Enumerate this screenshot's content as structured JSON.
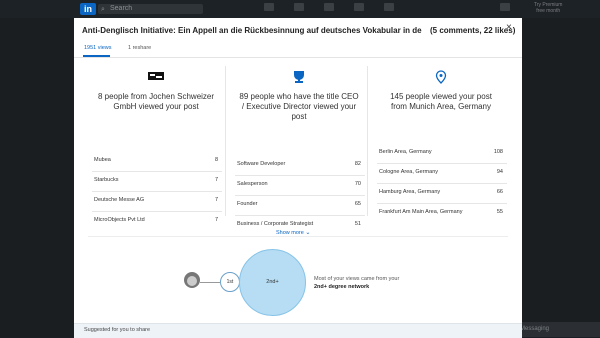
{
  "header": {
    "logo": "in",
    "search_placeholder": "Search",
    "premium_label": "Try Premium\nfree month"
  },
  "background": {
    "messaging": "Messaging"
  },
  "modal": {
    "title": "Anti-Denglisch Initiative: Ein Appell an die Rückbesinnung auf deutsches Vokabular in der Grü...",
    "stats": "(5 comments, 22 likes)",
    "close": "×",
    "tabs": [
      {
        "label": "1951 views",
        "active": true
      },
      {
        "label": "1 reshare",
        "active": false
      }
    ],
    "columns": [
      {
        "icon": "company-logo-icon",
        "headline": "8 people from Jochen Schweizer GmbH viewed your post",
        "rows": [
          {
            "label": "Mubea",
            "value": "8"
          },
          {
            "label": "Starbucks",
            "value": "7"
          },
          {
            "label": "Deutsche Messe AG",
            "value": "7"
          },
          {
            "label": "MicroObjects Pvt Ltd",
            "value": "7"
          }
        ]
      },
      {
        "icon": "trophy-icon",
        "headline": "89 people who have the title CEO / Executive Director viewed your post",
        "rows": [
          {
            "label": "Software Developer",
            "value": "82"
          },
          {
            "label": "Salesperson",
            "value": "70"
          },
          {
            "label": "Founder",
            "value": "65"
          },
          {
            "label": "Business / Corporate Strategist",
            "value": "51"
          }
        ]
      },
      {
        "icon": "location-pin-icon",
        "headline": "145 people viewed your post from Munich Area, Germany",
        "rows": [
          {
            "label": "Berlin Area, Germany",
            "value": "108"
          },
          {
            "label": "Cologne Area, Germany",
            "value": "94"
          },
          {
            "label": "Hamburg Area, Germany",
            "value": "66"
          },
          {
            "label": "Frankfurt Am Main Area, Germany",
            "value": "55"
          }
        ]
      }
    ],
    "show_more": "Show more",
    "network": {
      "first_label": "1st",
      "second_label": "2nd+",
      "note_prefix": "Most of your views came from your",
      "note_bold": "2nd+ degree network"
    },
    "suggested": "Suggested for you to share"
  },
  "colors": {
    "accent": "#0a66c2",
    "bubble": "#b6ddf3"
  }
}
